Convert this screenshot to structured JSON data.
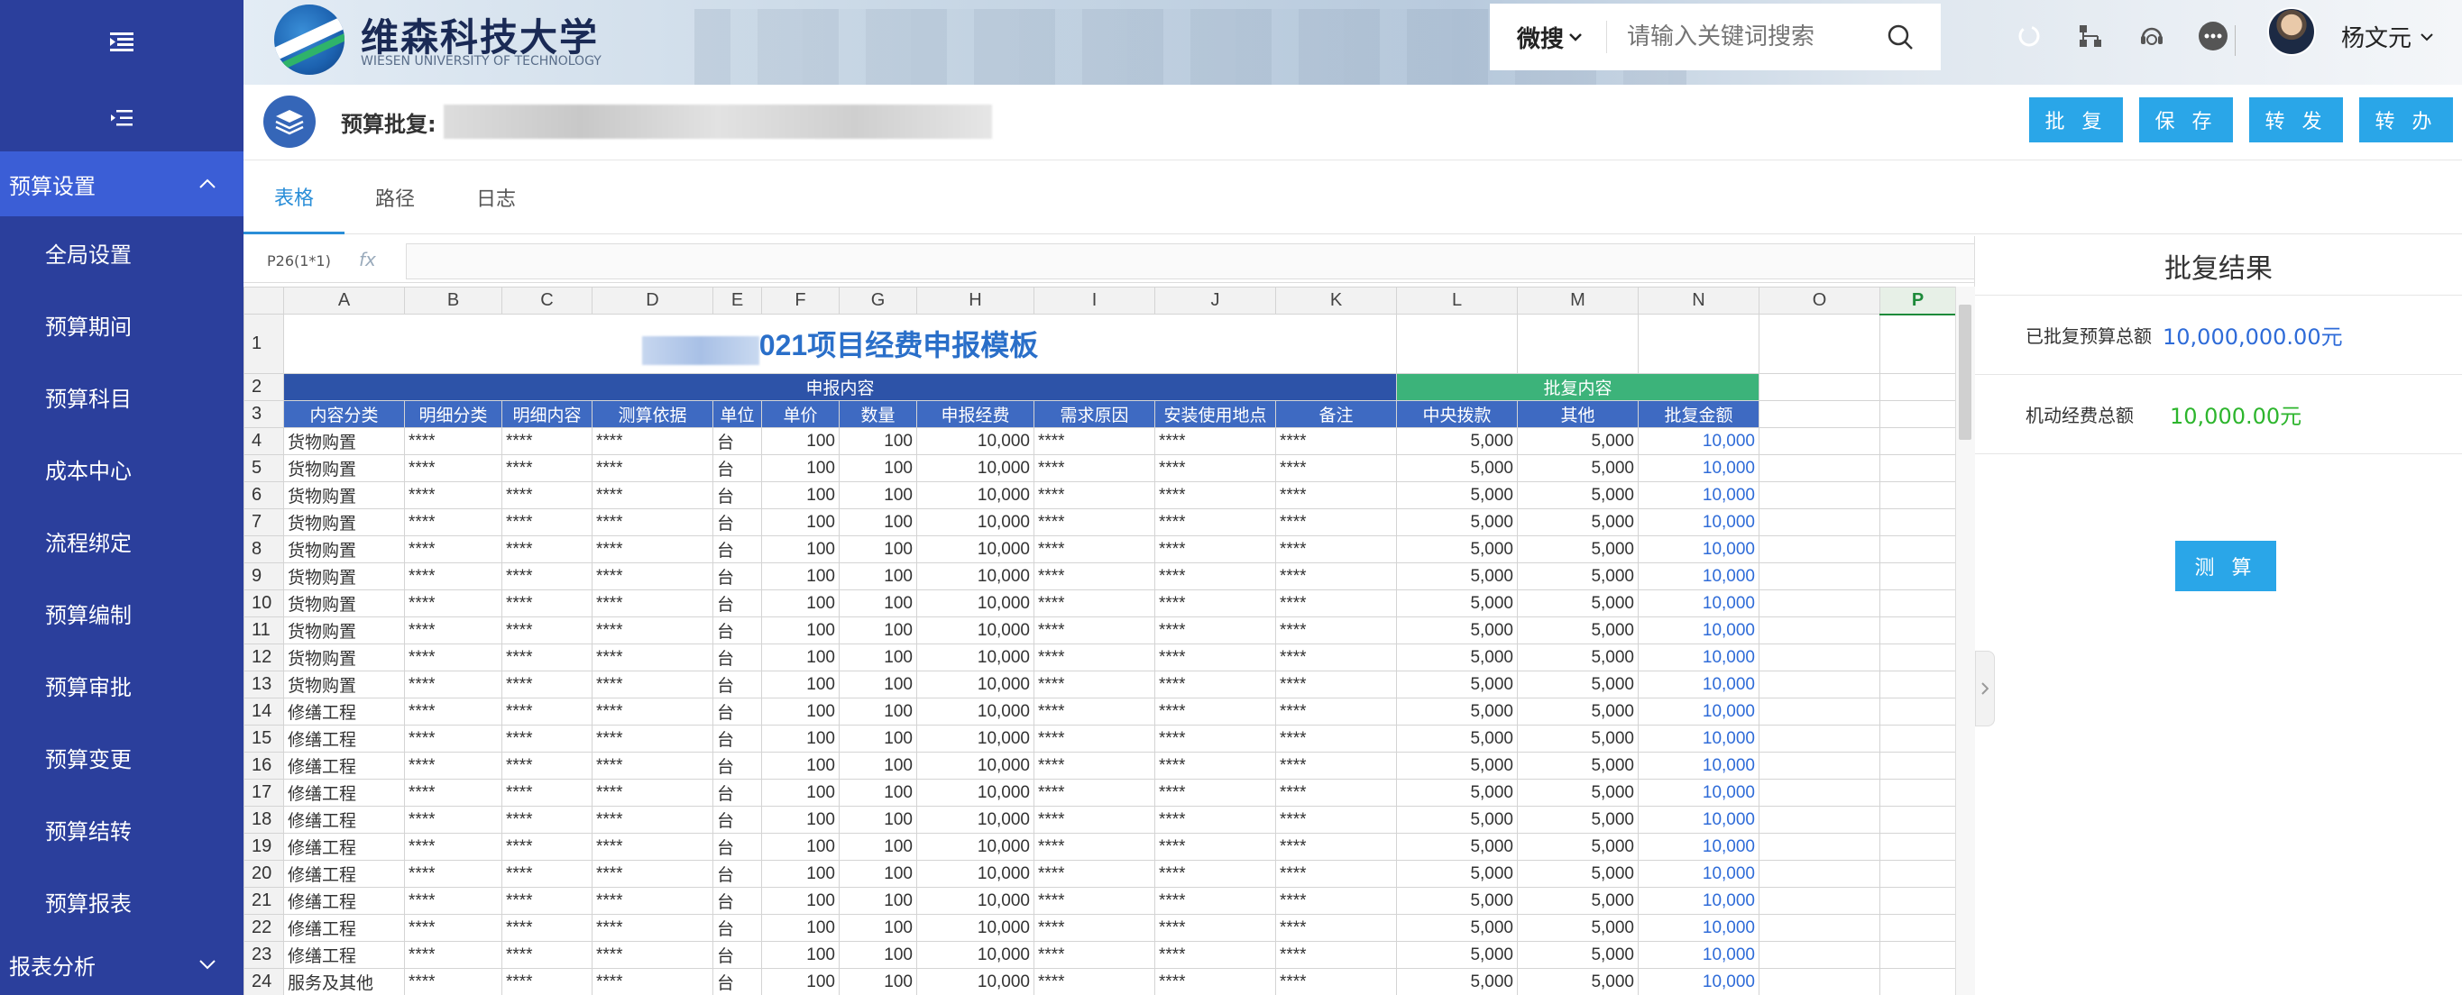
{
  "header": {
    "university_name": "维森科技大学",
    "university_sub": "WIESEN UNIVERSITY OF TECHNOLOGY",
    "search_scope": "微搜",
    "search_placeholder": "请输入关键词搜索",
    "user_name": "杨文元"
  },
  "sidebar": {
    "group_budget": "预算设置",
    "items": [
      "全局设置",
      "预算期间",
      "预算科目",
      "成本中心",
      "流程绑定",
      "预算编制",
      "预算审批",
      "预算变更",
      "预算结转",
      "预算报表"
    ],
    "group_report": "报表分析"
  },
  "subheader": {
    "title": "预算批复:",
    "actions": [
      "批 复",
      "保 存",
      "转 发",
      "转 办"
    ]
  },
  "tabs": [
    "表格",
    "路径",
    "日志"
  ],
  "sheet": {
    "cell_ref": "P26(1*1)",
    "fx": "fx",
    "columns": [
      "",
      "A",
      "B",
      "C",
      "D",
      "E",
      "F",
      "G",
      "H",
      "I",
      "J",
      "K",
      "L",
      "M",
      "N",
      "O",
      "P"
    ],
    "title": "021项目经费申报模板",
    "group_apply": "申报内容",
    "group_approve": "批复内容",
    "headers": [
      "内容分类",
      "明细分类",
      "明细内容",
      "测算依据",
      "单位",
      "单价",
      "数量",
      "申报经费",
      "需求原因",
      "安装使用地点",
      "备注",
      "中央拨款",
      "其他",
      "批复金额"
    ],
    "rows": [
      {
        "n": "4",
        "cat": "货物购置"
      },
      {
        "n": "5",
        "cat": "货物购置"
      },
      {
        "n": "6",
        "cat": "货物购置"
      },
      {
        "n": "7",
        "cat": "货物购置"
      },
      {
        "n": "8",
        "cat": "货物购置"
      },
      {
        "n": "9",
        "cat": "货物购置"
      },
      {
        "n": "10",
        "cat": "货物购置"
      },
      {
        "n": "11",
        "cat": "货物购置"
      },
      {
        "n": "12",
        "cat": "货物购置"
      },
      {
        "n": "13",
        "cat": "货物购置"
      },
      {
        "n": "14",
        "cat": "修缮工程"
      },
      {
        "n": "15",
        "cat": "修缮工程"
      },
      {
        "n": "16",
        "cat": "修缮工程"
      },
      {
        "n": "17",
        "cat": "修缮工程"
      },
      {
        "n": "18",
        "cat": "修缮工程"
      },
      {
        "n": "19",
        "cat": "修缮工程"
      },
      {
        "n": "20",
        "cat": "修缮工程"
      },
      {
        "n": "21",
        "cat": "修缮工程"
      },
      {
        "n": "22",
        "cat": "修缮工程"
      },
      {
        "n": "23",
        "cat": "修缮工程"
      },
      {
        "n": "24",
        "cat": "服务及其他"
      }
    ],
    "row_values": {
      "masked": "****",
      "unit": "台",
      "price": "100",
      "qty": "100",
      "apply": "10,000",
      "central": "5,000",
      "other": "5,000",
      "approved": "10,000"
    }
  },
  "result": {
    "title": "批复结果",
    "total_label": "已批复预算总额",
    "total_value": "10,000,000.00元",
    "flex_label": "机动经费总额",
    "flex_value": "10,000.00元",
    "calc_button": "测 算"
  },
  "colors": {
    "sidebar": "#2b3f9c",
    "sidebar_active": "#3b5ed6",
    "action_button": "#2aa6e8",
    "total_value": "#2e6bd8",
    "flex_value": "#2db52d"
  }
}
